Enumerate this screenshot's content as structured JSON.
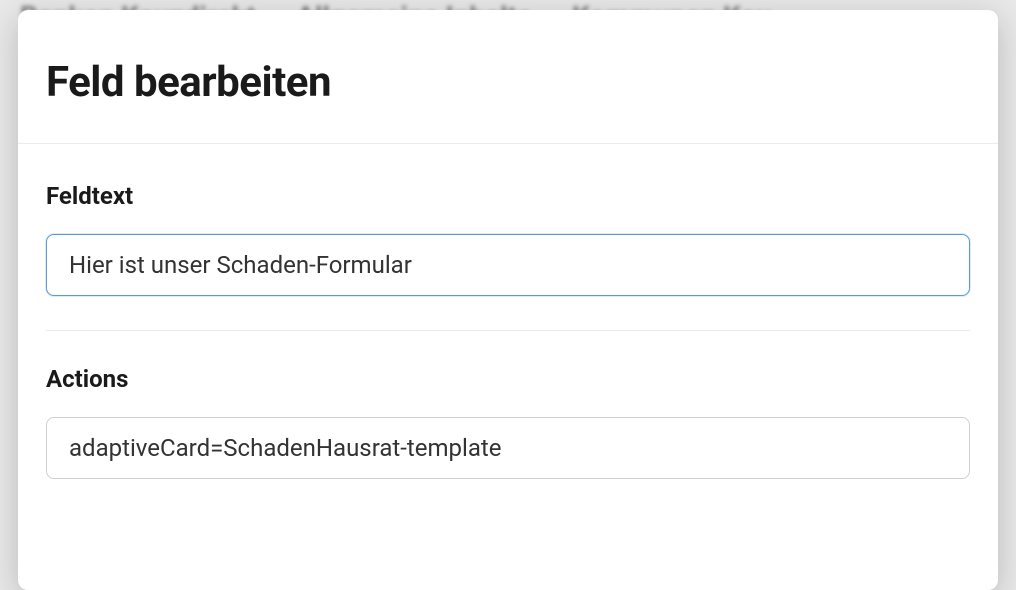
{
  "background_nav": {
    "item1": "Banken Kauzdirekt",
    "item2": "Allgemeine Inhalte",
    "item3": "Kommunen Kau"
  },
  "modal": {
    "title": "Feld bearbeiten",
    "feldtext": {
      "label": "Feldtext",
      "value": "Hier ist unser Schaden-Formular"
    },
    "actions": {
      "label": "Actions",
      "value": "adaptiveCard=SchadenHausrat-template"
    }
  }
}
